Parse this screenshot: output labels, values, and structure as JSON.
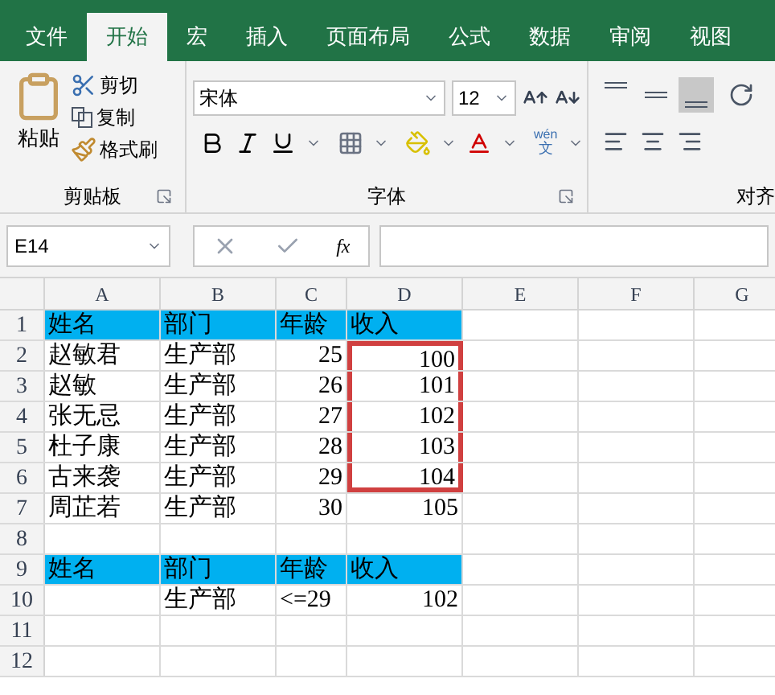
{
  "tabs": [
    {
      "label": "文件",
      "selected": false
    },
    {
      "label": "开始",
      "selected": true
    },
    {
      "label": "宏",
      "selected": false
    },
    {
      "label": "插入",
      "selected": false
    },
    {
      "label": "页面布局",
      "selected": false
    },
    {
      "label": "公式",
      "selected": false
    },
    {
      "label": "数据",
      "selected": false
    },
    {
      "label": "审阅",
      "selected": false
    },
    {
      "label": "视图",
      "selected": false
    }
  ],
  "clipboard": {
    "paste": "粘贴",
    "cut": "剪切",
    "copy": "复制",
    "format_painter": "格式刷",
    "label": "剪贴板"
  },
  "font": {
    "font_name": "宋体",
    "font_size": "12",
    "phonetic_top": "wén",
    "phonetic_bottom": "文",
    "label": "字体"
  },
  "alignment": {
    "vertical": [
      {
        "kind": "top",
        "selected": false
      },
      {
        "kind": "middle",
        "selected": false
      },
      {
        "kind": "bottom",
        "selected": true
      }
    ],
    "label": "对齐"
  },
  "name_box": "E14",
  "fx": "fx",
  "columns": [
    "A",
    "B",
    "C",
    "D",
    "E",
    "F",
    "G"
  ],
  "rows": [
    {
      "number": "1",
      "highlighted": true,
      "cells": [
        {
          "text": "姓名",
          "kind": "text"
        },
        {
          "text": "部门",
          "kind": "text"
        },
        {
          "text": "年龄",
          "kind": "text"
        },
        {
          "text": "收入",
          "kind": "text"
        }
      ]
    },
    {
      "number": "2",
      "highlighted": false,
      "cells": [
        {
          "text": "赵敏君",
          "kind": "text"
        },
        {
          "text": "生产部",
          "kind": "text"
        },
        {
          "text": "25",
          "kind": "number"
        },
        {
          "text": "100",
          "kind": "number",
          "boxed": true
        }
      ]
    },
    {
      "number": "3",
      "highlighted": false,
      "cells": [
        {
          "text": "赵敏",
          "kind": "text"
        },
        {
          "text": "生产部",
          "kind": "text"
        },
        {
          "text": "26",
          "kind": "number"
        },
        {
          "text": "101",
          "kind": "number",
          "boxed": true
        }
      ]
    },
    {
      "number": "4",
      "highlighted": false,
      "cells": [
        {
          "text": "张无忌",
          "kind": "text"
        },
        {
          "text": "生产部",
          "kind": "text"
        },
        {
          "text": "27",
          "kind": "number"
        },
        {
          "text": "102",
          "kind": "number",
          "boxed": true
        }
      ]
    },
    {
      "number": "5",
      "highlighted": false,
      "cells": [
        {
          "text": "杜子康",
          "kind": "text"
        },
        {
          "text": "生产部",
          "kind": "text"
        },
        {
          "text": "28",
          "kind": "number"
        },
        {
          "text": "103",
          "kind": "number",
          "boxed": true
        }
      ]
    },
    {
      "number": "6",
      "highlighted": false,
      "cells": [
        {
          "text": "古来袭",
          "kind": "text"
        },
        {
          "text": "生产部",
          "kind": "text"
        },
        {
          "text": "29",
          "kind": "number"
        },
        {
          "text": "104",
          "kind": "number",
          "boxed": true
        }
      ]
    },
    {
      "number": "7",
      "highlighted": false,
      "cells": [
        {
          "text": "周芷若",
          "kind": "text"
        },
        {
          "text": "生产部",
          "kind": "text"
        },
        {
          "text": "30",
          "kind": "number"
        },
        {
          "text": "105",
          "kind": "number"
        }
      ]
    },
    {
      "number": "8",
      "highlighted": false
    },
    {
      "number": "9",
      "highlighted": true,
      "cells": [
        {
          "text": "姓名",
          "kind": "text"
        },
        {
          "text": "部门",
          "kind": "text"
        },
        {
          "text": "年龄",
          "kind": "text"
        },
        {
          "text": "收入",
          "kind": "text"
        }
      ]
    },
    {
      "number": "10",
      "highlighted": false,
      "cells": [
        null,
        {
          "text": "生产部",
          "kind": "text"
        },
        {
          "text": "<=29",
          "kind": "text"
        },
        {
          "text": "102",
          "kind": "number"
        }
      ]
    },
    {
      "number": "11",
      "highlighted": false
    },
    {
      "number": "12",
      "highlighted": false
    }
  ]
}
